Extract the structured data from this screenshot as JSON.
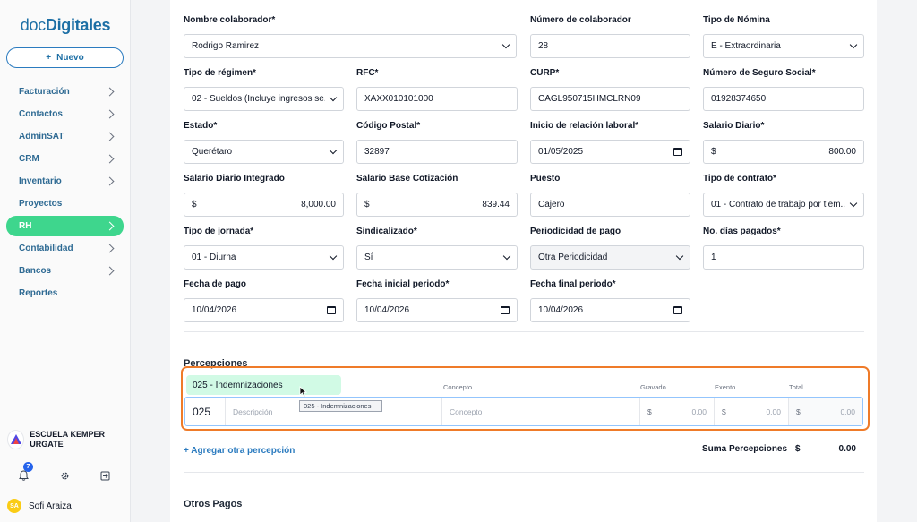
{
  "sidebar": {
    "logo_part1": "doc",
    "logo_part2": "Digitales",
    "new_button": "Nuevo",
    "items": [
      {
        "label": "Facturación",
        "chevron": true
      },
      {
        "label": "Contactos",
        "chevron": true
      },
      {
        "label": "AdminSAT",
        "chevron": true
      },
      {
        "label": "CRM",
        "chevron": true
      },
      {
        "label": "Inventario",
        "chevron": true
      },
      {
        "label": "Proyectos",
        "chevron": false
      },
      {
        "label": "RH",
        "chevron": true,
        "active": true
      },
      {
        "label": "Contabilidad",
        "chevron": true
      },
      {
        "label": "Bancos",
        "chevron": true
      },
      {
        "label": "Reportes",
        "chevron": false
      }
    ],
    "org_name": "ESCUELA KEMPER URGATE",
    "notification_count": "7",
    "user_initials": "SA",
    "user_name": "Sofi Araiza"
  },
  "form": {
    "nombre_colaborador": {
      "label": "Nombre colaborador*",
      "value": "Rodrigo Ramirez"
    },
    "numero_colaborador": {
      "label": "Número de colaborador",
      "value": "28"
    },
    "tipo_nomina": {
      "label": "Tipo de Nómina",
      "value": "E - Extraordinaria"
    },
    "tipo_regimen": {
      "label": "Tipo de régimen*",
      "value": "02 - Sueldos (Incluye ingresos se..."
    },
    "rfc": {
      "label": "RFC*",
      "value": "XAXX010101000"
    },
    "curp": {
      "label": "CURP*",
      "value": "CAGL950715HMCLRN09"
    },
    "nss": {
      "label": "Número de Seguro Social*",
      "value": "01928374650"
    },
    "estado": {
      "label": "Estado*",
      "value": "Querétaro"
    },
    "codigo_postal": {
      "label": "Código Postal*",
      "value": "32897"
    },
    "inicio_relacion": {
      "label": "Inicio de relación laboral*",
      "value": "01/05/2025"
    },
    "salario_diario": {
      "label": "Salario Diario*",
      "currency": "$",
      "value": "800.00"
    },
    "sdi": {
      "label": "Salario Diario Integrado",
      "currency": "$",
      "value": "8,000.00"
    },
    "sbc": {
      "label": "Salario Base Cotización",
      "currency": "$",
      "value": "839.44"
    },
    "puesto": {
      "label": "Puesto",
      "value": "Cajero"
    },
    "tipo_contrato": {
      "label": "Tipo de contrato*",
      "value": "01 - Contrato de trabajo por tiem..."
    },
    "tipo_jornada": {
      "label": "Tipo de jornada*",
      "value": "01 - Diurna"
    },
    "sindicalizado": {
      "label": "Sindicalizado*",
      "value": "Sí"
    },
    "periodicidad": {
      "label": "Periodicidad de pago",
      "value": "Otra Periodicidad"
    },
    "dias_pagados": {
      "label": "No. días pagados*",
      "value": "1"
    },
    "fecha_pago": {
      "label": "Fecha de pago",
      "value": "10/04/2026"
    },
    "fecha_inicial": {
      "label": "Fecha inicial periodo*",
      "value": "10/04/2026"
    },
    "fecha_final": {
      "label": "Fecha final periodo*",
      "value": "10/04/2026"
    }
  },
  "percepciones": {
    "title": "Percepciones",
    "columns": {
      "concepto": "Concepto",
      "gravado": "Gravado",
      "exento": "Exento",
      "total": "Total"
    },
    "row": {
      "code": "025",
      "descripcion_placeholder": "Descripción",
      "concepto_placeholder": "Concepto",
      "currency": "$",
      "gravado": "0.00",
      "exento": "0.00",
      "total": "0.00"
    },
    "dropdown_option": "025 - Indemnizaciones",
    "tooltip": "025 - Indemnizaciones",
    "add_link": "+ Agregar otra percepción",
    "sum_label": "Suma Percepciones",
    "sum_currency": "$",
    "sum_value": "0.00"
  },
  "otros_pagos": {
    "title": "Otros Pagos"
  },
  "colors": {
    "accent_green": "#3ed68d",
    "brand_blue": "#1d6fa5",
    "highlight_orange": "#ef7b29"
  }
}
